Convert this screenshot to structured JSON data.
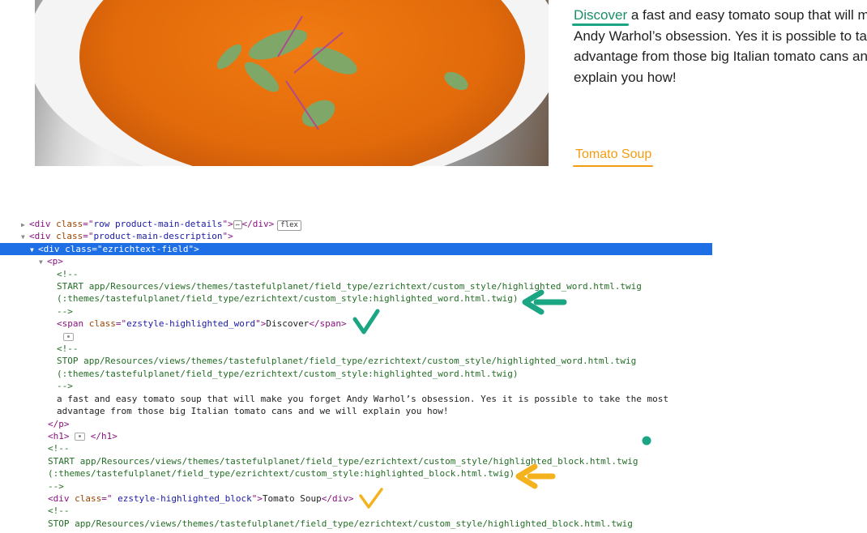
{
  "product": {
    "description_highlight": "Discover",
    "description_lines": [
      " a fast and easy tomato soup that will make",
      "Andy Warhol’s obsession. Yes it is possible to take th",
      "advantage from those big Italian tomato cans and w",
      "explain you how!"
    ],
    "block_title": "Tomato Soup"
  },
  "devtools": {
    "row_div_class": "row product-main-details",
    "flex_badge": "flex",
    "main_desc_class": "product-main-description",
    "selected_div_class": "ezrichtext-field",
    "p_tag": "p",
    "comment_open": "<!--",
    "comment_close": "-->",
    "start_word": "START app/Resources/views/themes/tastefulplanet/field_type/ezrichtext/custom_style/highlighted_word.html.twig",
    "word_alias": "(:themes/tastefulplanet/field_type/ezrichtext/custom_style:highlighted_word.html.twig)",
    "span_class": "ezstyle-highlighted_word",
    "span_text": "Discover",
    "stop_word": "STOP app/Resources/views/themes/tastefulplanet/field_type/ezrichtext/custom_style/highlighted_word.html.twig",
    "stop_word_alias": "(:themes/tastefulplanet/field_type/ezrichtext/custom_style:highlighted_word.html.twig)",
    "text_line1": "a fast and easy tomato soup that will make you forget Andy Warhol’s obsession. Yes it is possible to take the most",
    "text_line2": "advantage from those big Italian tomato cans and we will explain you how!",
    "p_close": "/p",
    "h1_tag": "h1",
    "h1_close": "/h1",
    "start_block": "START app/Resources/views/themes/tastefulplanet/field_type/ezrichtext/custom_style/highlighted_block.html.twig",
    "block_alias": "(:themes/tastefulplanet/field_type/ezrichtext/custom_style:highlighted_block.html.twig)",
    "div_block_class": " ezstyle-highlighted_block",
    "div_block_text": "Tomato Soup",
    "stop_block": "STOP app/Resources/views/themes/tastefulplanet/field_type/ezrichtext/custom_style/highlighted_block.html.twig"
  },
  "colors": {
    "teal_annotation": "#1aa583",
    "orange_annotation": "#f3b21e",
    "selection": "#1e6fe6"
  },
  "icons": [
    "soup-photo",
    "arrow-left-icon",
    "checkmark-icon",
    "eye-icon",
    "ellipsis-icon",
    "dot-icon"
  ]
}
